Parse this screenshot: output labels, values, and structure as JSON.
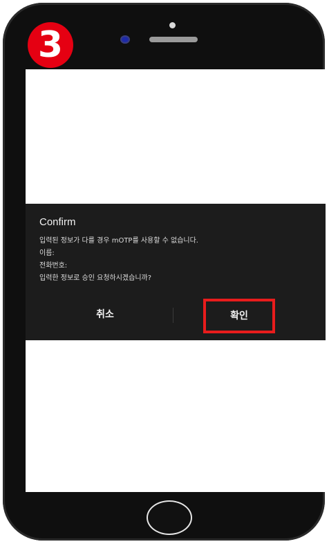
{
  "step_badge": {
    "number": "3",
    "color": "#e50012"
  },
  "dialog": {
    "title": "Confirm",
    "lines": [
      "입력된 정보가 다를 경우 mOTP를 사용할 수 없습니다.",
      "이름:",
      "전화번호:",
      "입력한 정보로 승인 요청하시겠습니까?"
    ],
    "cancel_label": "취소",
    "confirm_label": "확인",
    "highlight_color": "#e81c1c"
  },
  "device": {
    "home_button_icon": "home-button-circle",
    "camera_icon": "front-camera",
    "speaker_icon": "earpiece-speaker"
  }
}
